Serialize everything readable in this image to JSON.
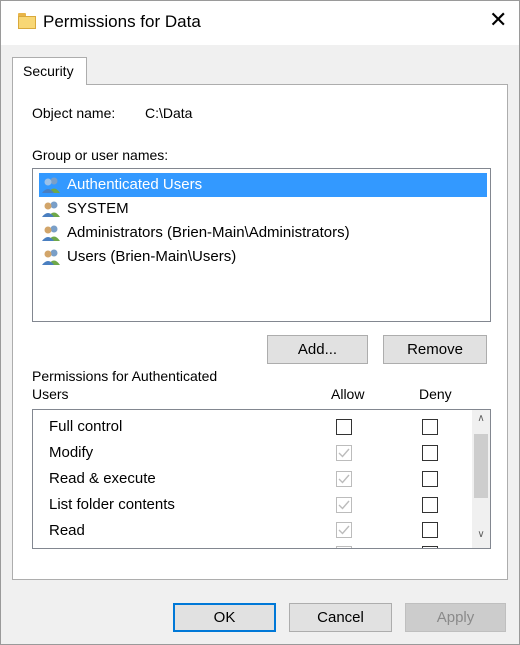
{
  "window": {
    "title": "Permissions for Data"
  },
  "tabs": [
    {
      "label": "Security"
    }
  ],
  "object": {
    "label": "Object name:",
    "value": "C:\\Data"
  },
  "groups": {
    "label": "Group or user names:",
    "items": [
      {
        "label": "Authenticated Users",
        "selected": true
      },
      {
        "label": "SYSTEM"
      },
      {
        "label": "Administrators (Brien-Main\\Administrators)"
      },
      {
        "label": "Users (Brien-Main\\Users)"
      }
    ]
  },
  "buttons": {
    "add": "Add...",
    "remove": "Remove",
    "ok": "OK",
    "cancel": "Cancel",
    "apply": "Apply"
  },
  "permissions": {
    "header_line1": "Permissions for Authenticated",
    "header_line2": "Users",
    "allow_label": "Allow",
    "deny_label": "Deny",
    "rows": [
      {
        "label": "Full control",
        "allow": "unchecked",
        "deny": "unchecked"
      },
      {
        "label": "Modify",
        "allow": "checked-disabled",
        "deny": "unchecked"
      },
      {
        "label": "Read & execute",
        "allow": "checked-disabled",
        "deny": "unchecked"
      },
      {
        "label": "List folder contents",
        "allow": "checked-disabled",
        "deny": "unchecked"
      },
      {
        "label": "Read",
        "allow": "checked-disabled",
        "deny": "unchecked"
      },
      {
        "label": "",
        "allow": "checked-disabled",
        "deny": "unchecked"
      }
    ]
  },
  "icons": {
    "title": "folder-icon",
    "close": "close-icon",
    "user": "user-group-icon",
    "scroll_up": "chevron-up-icon",
    "scroll_down": "chevron-down-icon"
  },
  "colors": {
    "selection": "#3399ff",
    "default_button_border": "#0078d7",
    "folder": "#f8d775"
  }
}
